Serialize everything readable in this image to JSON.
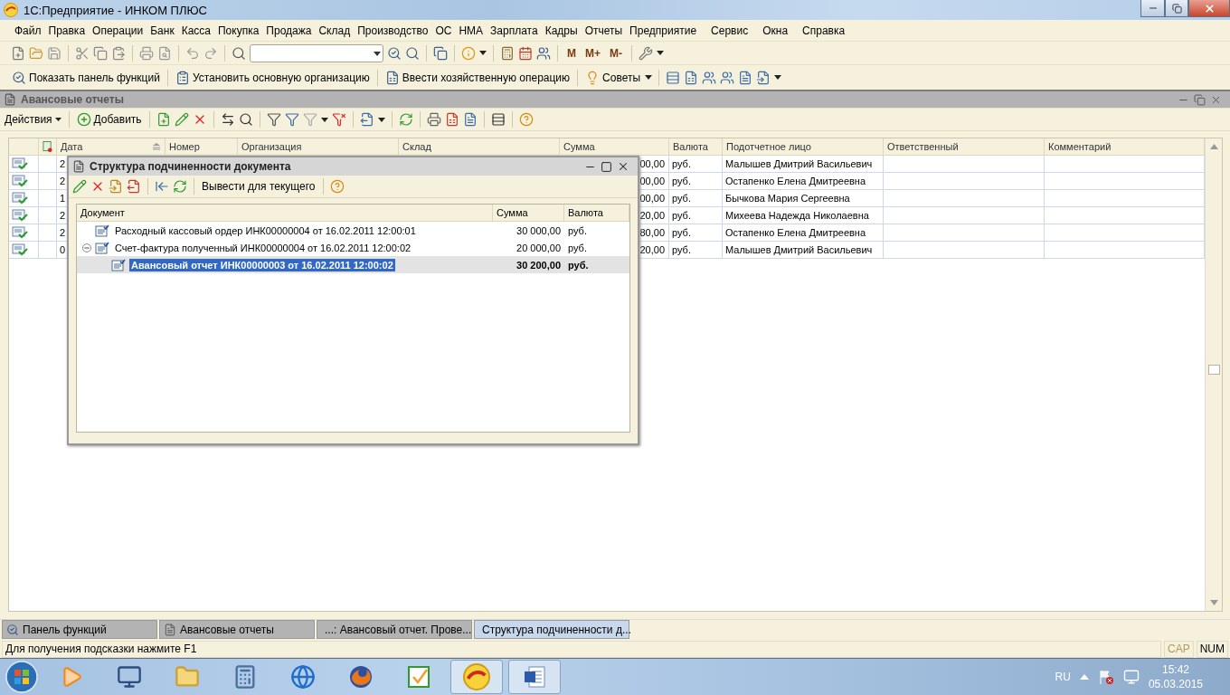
{
  "window": {
    "title": "1С:Предприятие - ИНКОМ ПЛЮС"
  },
  "menu": [
    "Файл",
    "Правка",
    "Операции",
    "Банк",
    "Касса",
    "Покупка",
    "Продажа",
    "Склад",
    "Производство",
    "ОС",
    "НМА",
    "Зарплата",
    "Кадры",
    "Отчеты",
    "Предприятие",
    "Сервис",
    "Окна",
    "Справка"
  ],
  "memory_buttons": [
    "M",
    "M+",
    "M-"
  ],
  "function_toolbar": [
    "Показать панель функций",
    "Установить основную организацию",
    "Ввести хозяйственную операцию",
    "Советы"
  ],
  "document_window": {
    "title": "Авансовые отчеты",
    "actions": "Действия",
    "add": "Добавить"
  },
  "table": {
    "columns": [
      "Дата",
      "Номер",
      "Организация",
      "Склад",
      "Сумма",
      "Валюта",
      "Подотчетное лицо",
      "Ответственный",
      "Комментарий"
    ],
    "rows": [
      {
        "date": "2",
        "sum": "00,00",
        "currency": "руб.",
        "person": "Малышев Дмитрий Васильевич"
      },
      {
        "date": "2",
        "sum": "00,00",
        "currency": "руб.",
        "person": "Остапенко Елена Дмитреевна"
      },
      {
        "date": "1",
        "sum": "00,00",
        "currency": "руб.",
        "person": "Бычкова Мария Сергеевна"
      },
      {
        "date": "2",
        "sum": "20,00",
        "currency": "руб.",
        "person": "Михеева Надежда Николаевна"
      },
      {
        "date": "2",
        "sum": "80,00",
        "currency": "руб.",
        "person": "Остапенко Елена Дмитреевна"
      },
      {
        "date": "0",
        "sum": "20,00",
        "currency": "руб.",
        "person": "Малышев Дмитрий Васильевич"
      }
    ]
  },
  "dialog": {
    "title": "Структура подчиненности документа",
    "button": "Вывести для текущего",
    "columns": [
      "Документ",
      "Сумма",
      "Валюта"
    ],
    "tree": [
      {
        "label": "Расходный кассовый ордер ИНК00000004 от 16.02.2011 12:00:01",
        "sum": "30 000,00",
        "currency": "руб.",
        "selected": false
      },
      {
        "label": "Счет-фактура полученный ИНК00000004 от 16.02.2011 12:00:02",
        "sum": "20 000,00",
        "currency": "руб.",
        "selected": false,
        "expanded": true,
        "children": [
          {
            "label": "Авансовый отчет ИНК00000003 от 16.02.2011 12:00:02",
            "sum": "30 200,00",
            "currency": "руб.",
            "selected": true
          }
        ]
      }
    ]
  },
  "window_tabs": [
    {
      "label": "Панель функций",
      "selected": false
    },
    {
      "label": "Авансовые отчеты",
      "selected": false
    },
    {
      "label": "...: Авансовый отчет. Прове...",
      "selected": false
    },
    {
      "label": "Структура подчиненности д...",
      "selected": true
    }
  ],
  "status": {
    "hint": "Для получения подсказки нажмите F1",
    "indicators": [
      {
        "label": "CAP",
        "on": false
      },
      {
        "label": "NUM",
        "on": true
      }
    ]
  },
  "taskbar": {
    "language": "RU",
    "time": "15:42",
    "date": "05.03.2015"
  }
}
